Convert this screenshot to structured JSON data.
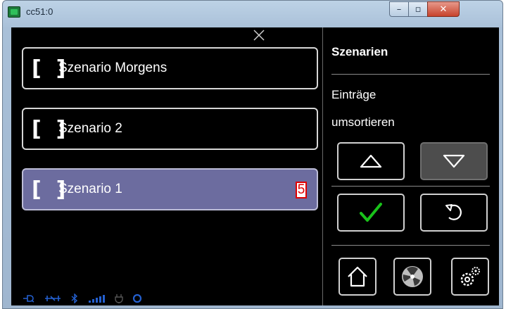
{
  "window": {
    "title": "cc51:0",
    "minimize_glyph": "–",
    "maximize_glyph": "▫",
    "close_glyph": "✕"
  },
  "scenarios": [
    {
      "label": "Szenario Morgens",
      "bracket": "[  ]",
      "selected": false
    },
    {
      "label": "Szenario 2",
      "bracket": "[  ]",
      "selected": false
    },
    {
      "label": "Szenario 1",
      "bracket": "[  ]",
      "selected": true,
      "badge": "5"
    }
  ],
  "panel": {
    "title": "Szenarien",
    "line1": "Einträge",
    "line2": "umsortieren"
  },
  "icons": {
    "up": "triangle-up-icon",
    "down": "triangle-down-icon",
    "confirm": "checkmark-icon",
    "undo": "undo-icon",
    "home": "home-icon",
    "fan": "fan-icon",
    "settings": "gear-icon"
  },
  "colors": {
    "selected_bg": "#6c6c9f",
    "check_green": "#19c21a",
    "close_red": "#c7432c",
    "badge_red": "#e00000"
  }
}
